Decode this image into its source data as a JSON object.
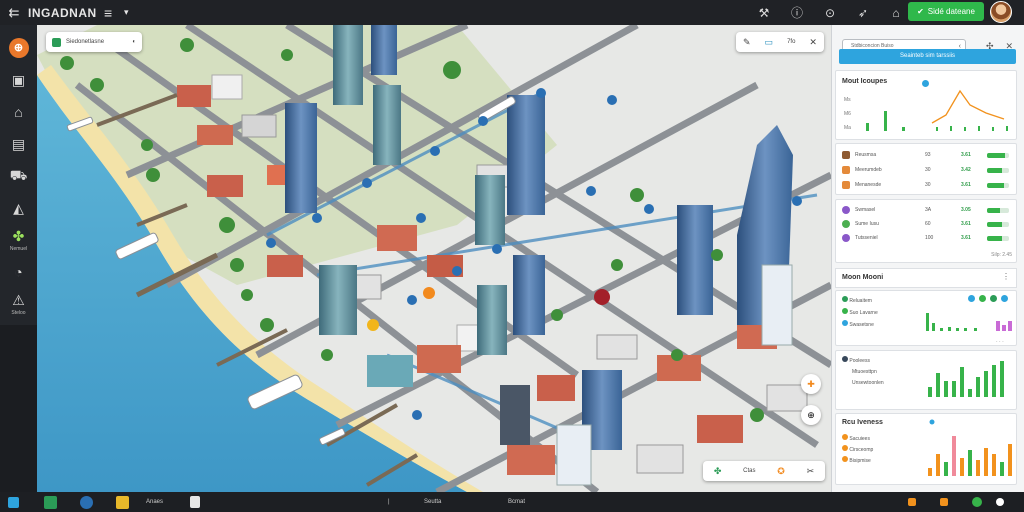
{
  "app": {
    "title": "INGADNAN",
    "back_icon": "arrows-collapse-icon",
    "menu_icon": "hamburger-icon"
  },
  "topbar": {
    "icons": [
      "tools-icon",
      "info-icon",
      "alert-icon",
      "share-icon",
      "home-icon"
    ],
    "action_button": {
      "label": "Sidé dateane",
      "color": "#2fb84b"
    }
  },
  "sidebar": {
    "items": [
      {
        "icon": "brand-logo",
        "label": ""
      },
      {
        "icon": "image-icon",
        "label": ""
      },
      {
        "icon": "building-icon",
        "label": ""
      },
      {
        "icon": "map-card-icon",
        "label": ""
      },
      {
        "icon": "truck-icon",
        "label": ""
      },
      {
        "icon": "mountain-icon",
        "label": ""
      },
      {
        "icon": "plant-icon",
        "label": "Nemuel",
        "active": true
      },
      {
        "icon": "clock-icon",
        "label": ""
      },
      {
        "icon": "warning-icon",
        "label": "Steloo"
      }
    ]
  },
  "map": {
    "location_chip": "Siedonetlasne",
    "tools": [
      "edit-icon",
      "layers-icon",
      "fit-icon",
      "close-icon"
    ],
    "tools_text": "7fo",
    "bottom_tools": [
      "plant-icon",
      "zoom-icon",
      "compass-icon",
      "layers-icon"
    ],
    "bottom_text": "Ctas"
  },
  "panel": {
    "search_placeholder": "Stdbiconcion Buiso",
    "apply_button": "Seainteb sim tarssiis",
    "chart_card": {
      "title": "Mout Icoupes",
      "y_labels": [
        "Ms",
        "M6",
        "Ma",
        "Ms"
      ]
    },
    "list1": [
      {
        "label": "Reusmsa",
        "value": "93",
        "pct": "3.61",
        "bar": 0.8,
        "color": "#8e5a32"
      },
      {
        "label": "Meerumdeb",
        "value": "30",
        "pct": "3.42",
        "bar": 0.7,
        "color": "#e48a3a"
      },
      {
        "label": "Menanesde",
        "value": "30",
        "pct": "3.61",
        "bar": 0.75,
        "color": "#e48a3a"
      }
    ],
    "list2": [
      {
        "label": "Swmasel",
        "value": "3A",
        "pct": "3.05",
        "bar": 0.6,
        "color": "#8a58c9"
      },
      {
        "label": "Sume Iusu",
        "value": "60",
        "pct": "3.61",
        "bar": 0.7,
        "color": "#4caf50"
      },
      {
        "label": "Tutsseniel",
        "value": "100",
        "pct": "3.61",
        "bar": 0.7,
        "color": "#8a58c9"
      }
    ],
    "list2_footer": "Silp: 2.45",
    "section2_title": "Moon Mooni",
    "bars1": {
      "labels": [
        "Reluaitem",
        "Suo Lavarne",
        "Swasetsne"
      ],
      "values": [
        6,
        3,
        1,
        2,
        1,
        1,
        1,
        1,
        2,
        2,
        5,
        1,
        2,
        2
      ]
    },
    "bars2": {
      "labels": [
        "Pooleess",
        "Mtuoesttpn",
        "Unsewtoonlen"
      ],
      "values": [
        1,
        2,
        6,
        3,
        3,
        8,
        2,
        5,
        7,
        9
      ]
    },
    "bars3": {
      "title": "Rcu Iveness",
      "labels": [
        "Sacuiees",
        "Cirsceomp",
        "Bisipmise"
      ],
      "values": [
        1,
        5,
        3,
        9,
        4,
        6,
        3,
        6,
        5,
        3,
        8
      ]
    }
  },
  "taskbar": {
    "items": [
      "Anaes",
      "Seutta",
      "Bcmat"
    ]
  }
}
